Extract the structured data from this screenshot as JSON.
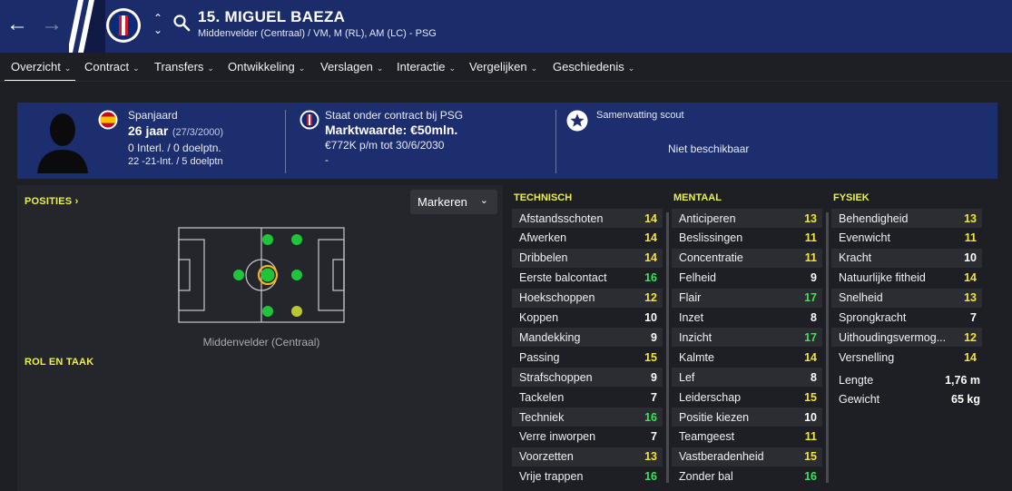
{
  "header": {
    "player_title": "15. MIGUEL BAEZA",
    "player_subtitle": "Middenvelder (Centraal) / VM, M (RL), AM (LC) - PSG",
    "icons": [
      "back-arrow-icon",
      "forward-arrow-icon",
      "club-crest-icon",
      "chevron-up-icon",
      "chevron-down-icon",
      "search-icon"
    ],
    "accent_color": "#1b2c6b"
  },
  "tabs": [
    {
      "label": "Overzicht",
      "active": true
    },
    {
      "label": "Contract"
    },
    {
      "label": "Transfers"
    },
    {
      "label": "Ontwikkeling"
    },
    {
      "label": "Verslagen"
    },
    {
      "label": "Interactie"
    },
    {
      "label": "Vergelijken"
    },
    {
      "label": "Geschiedenis"
    }
  ],
  "info": {
    "nationality": "Spanjaard",
    "age": "26 jaar",
    "dob": "(27/3/2000)",
    "caps": "0 Interl. / 0 doelptn.",
    "u21": "22 -21-Int. / 5 doelptn",
    "contract_status": "Staat onder contract bij PSG",
    "market_value": "Marktwaarde: €50mln.",
    "wage": "€772K p/m tot 30/6/2030",
    "extra": "-",
    "scout_title": "Samenvatting scout",
    "scout_text": "Niet beschikbaar"
  },
  "positions": {
    "title": "POSITIES",
    "role_title": "ROL EN TAAK",
    "markeren_label": "Markeren",
    "pitch_label": "Middenvelder (Centraal)"
  },
  "technical": {
    "title": "TECHNISCH",
    "rows": [
      {
        "label": "Afstandsschoten",
        "value": "14",
        "color": "yellow"
      },
      {
        "label": "Afwerken",
        "value": "14",
        "color": "yellow"
      },
      {
        "label": "Dribbelen",
        "value": "14",
        "color": "yellow"
      },
      {
        "label": "Eerste balcontact",
        "value": "16",
        "color": "green"
      },
      {
        "label": "Hoekschoppen",
        "value": "12",
        "color": "yellow"
      },
      {
        "label": "Koppen",
        "value": "10",
        "color": "white"
      },
      {
        "label": "Mandekking",
        "value": "9",
        "color": "white"
      },
      {
        "label": "Passing",
        "value": "15",
        "color": "yellow"
      },
      {
        "label": "Strafschoppen",
        "value": "9",
        "color": "white"
      },
      {
        "label": "Tackelen",
        "value": "7",
        "color": "white"
      },
      {
        "label": "Techniek",
        "value": "16",
        "color": "green"
      },
      {
        "label": "Verre inworpen",
        "value": "7",
        "color": "white"
      },
      {
        "label": "Voorzetten",
        "value": "13",
        "color": "yellow"
      },
      {
        "label": "Vrije trappen",
        "value": "16",
        "color": "green"
      }
    ]
  },
  "mental": {
    "title": "MENTAAL",
    "rows": [
      {
        "label": "Anticiperen",
        "value": "13",
        "color": "yellow"
      },
      {
        "label": "Beslissingen",
        "value": "11",
        "color": "yellow"
      },
      {
        "label": "Concentratie",
        "value": "11",
        "color": "yellow"
      },
      {
        "label": "Felheid",
        "value": "9",
        "color": "white"
      },
      {
        "label": "Flair",
        "value": "17",
        "color": "green"
      },
      {
        "label": "Inzet",
        "value": "8",
        "color": "white"
      },
      {
        "label": "Inzicht",
        "value": "17",
        "color": "green"
      },
      {
        "label": "Kalmte",
        "value": "14",
        "color": "yellow"
      },
      {
        "label": "Lef",
        "value": "8",
        "color": "white"
      },
      {
        "label": "Leiderschap",
        "value": "15",
        "color": "yellow"
      },
      {
        "label": "Positie kiezen",
        "value": "10",
        "color": "white"
      },
      {
        "label": "Teamgeest",
        "value": "11",
        "color": "yellow"
      },
      {
        "label": "Vastberadenheid",
        "value": "15",
        "color": "yellow"
      },
      {
        "label": "Zonder bal",
        "value": "16",
        "color": "green"
      }
    ]
  },
  "physical": {
    "title": "FYSIEK",
    "rows": [
      {
        "label": "Behendigheid",
        "value": "13",
        "color": "yellow"
      },
      {
        "label": "Evenwicht",
        "value": "11",
        "color": "yellow"
      },
      {
        "label": "Kracht",
        "value": "10",
        "color": "white"
      },
      {
        "label": "Natuurlijke fitheid",
        "value": "14",
        "color": "yellow"
      },
      {
        "label": "Snelheid",
        "value": "13",
        "color": "yellow"
      },
      {
        "label": "Sprongkracht",
        "value": "7",
        "color": "white"
      },
      {
        "label": "Uithoudingsvermog...",
        "value": "12",
        "color": "yellow"
      },
      {
        "label": "Versnelling",
        "value": "14",
        "color": "yellow"
      }
    ],
    "height_label": "Lengte",
    "height_value": "1,76 m",
    "weight_label": "Gewicht",
    "weight_value": "65 kg"
  }
}
